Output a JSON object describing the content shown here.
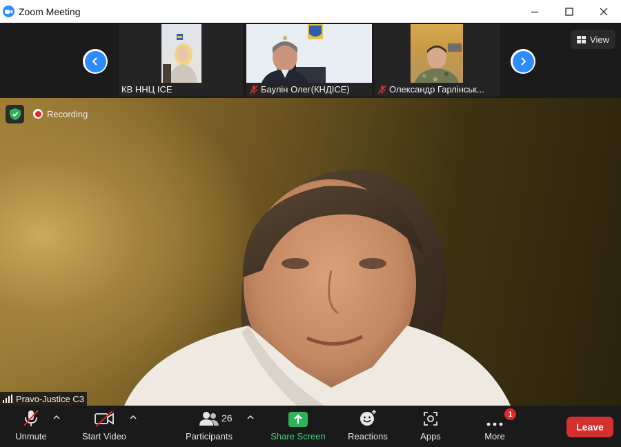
{
  "window": {
    "title": "Zoom Meeting",
    "logo_icon": "zoom-logo-icon",
    "controls": [
      "minimize-icon",
      "maximize-icon",
      "close-icon"
    ]
  },
  "gallery_strip": {
    "participants": [
      {
        "name": "КВ ННЦ ІСЕ",
        "muted": false
      },
      {
        "name": "Баулін Олег(КНДІСЕ)",
        "muted": true
      },
      {
        "name": "Олександр Гарлінськ...",
        "muted": true
      }
    ],
    "prev_icon": "chevron-left-icon",
    "next_icon": "chevron-right-icon",
    "view_label": "View"
  },
  "main_video": {
    "recording_label": "Recording",
    "speaker_name": "Pravo-Justice C3",
    "security_icon": "shield-check-icon"
  },
  "toolbar": {
    "unmute_label": "Unmute",
    "start_video_label": "Start Video",
    "participants_label": "Participants",
    "participants_count": "26",
    "share_screen_label": "Share Screen",
    "reactions_label": "Reactions",
    "apps_label": "Apps",
    "more_label": "More",
    "more_badge": "1",
    "leave_label": "Leave"
  },
  "colors": {
    "accent": "#2d8cff",
    "share_green": "#40d47e",
    "leave_red": "#d3302f",
    "recording_red": "#e02828"
  }
}
